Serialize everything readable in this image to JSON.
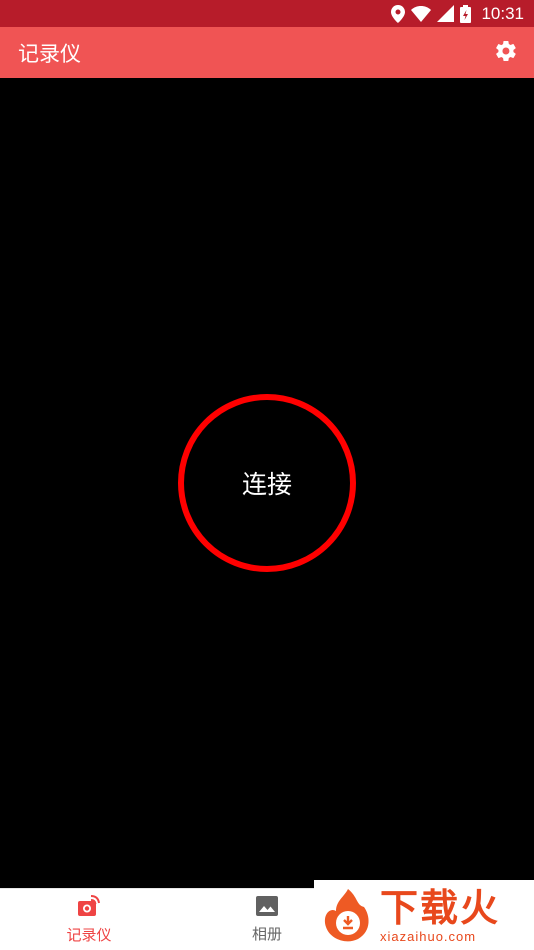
{
  "status_bar": {
    "time": "10:31"
  },
  "app_bar": {
    "title": "记录仪"
  },
  "main": {
    "connect_label": "连接"
  },
  "bottom_nav": {
    "items": [
      {
        "label": "记录仪",
        "active": true
      },
      {
        "label": "相册",
        "active": false
      }
    ]
  },
  "watermark": {
    "title": "下载火",
    "url": "xiazaihuo.com"
  },
  "colors": {
    "status_bar": "#b71c2a",
    "app_bar": "#f05454",
    "ring": "#ff0000",
    "accent": "#ef4444"
  }
}
